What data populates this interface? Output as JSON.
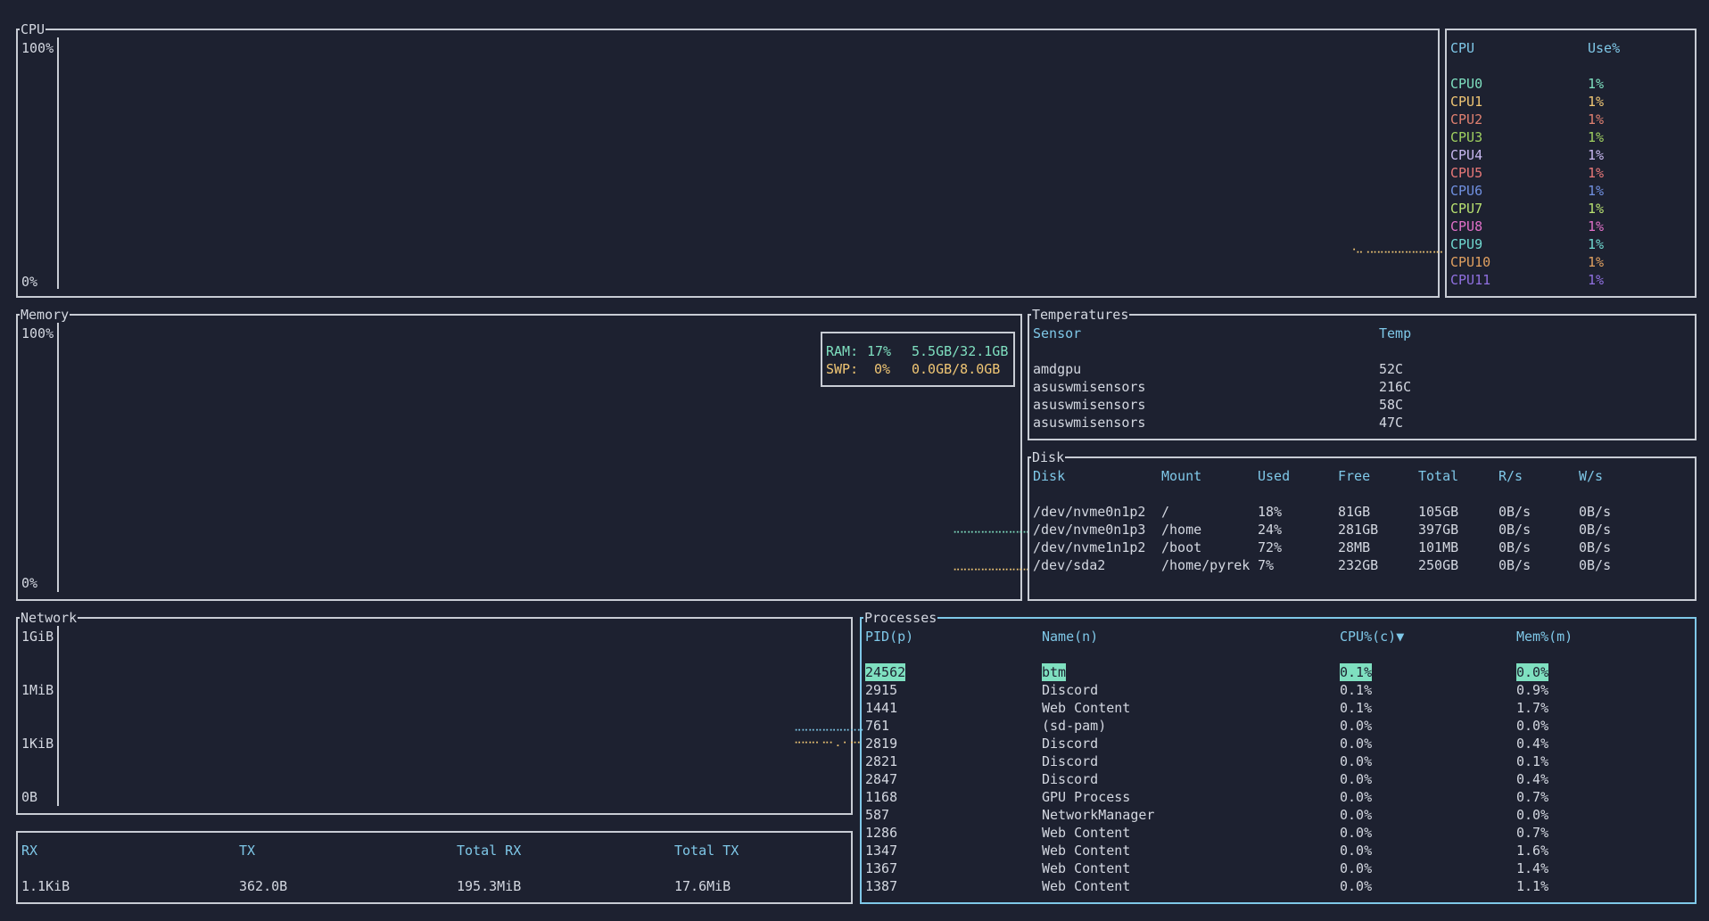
{
  "cpu_panel": {
    "title": "CPU",
    "y_max": "100%",
    "y_min": "0%"
  },
  "cpu_table": {
    "col_cpu": "CPU",
    "col_use": "Use%",
    "rows": [
      {
        "name": "CPU0",
        "use": "1%",
        "color": "#7fe0c0"
      },
      {
        "name": "CPU1",
        "use": "1%",
        "color": "#f0c674"
      },
      {
        "name": "CPU2",
        "use": "1%",
        "color": "#e08070"
      },
      {
        "name": "CPU3",
        "use": "1%",
        "color": "#a0d060"
      },
      {
        "name": "CPU4",
        "use": "1%",
        "color": "#c8b8f0"
      },
      {
        "name": "CPU5",
        "use": "1%",
        "color": "#e87878"
      },
      {
        "name": "CPU6",
        "use": "1%",
        "color": "#7090e0"
      },
      {
        "name": "CPU7",
        "use": "1%",
        "color": "#b8e070"
      },
      {
        "name": "CPU8",
        "use": "1%",
        "color": "#e070c8"
      },
      {
        "name": "CPU9",
        "use": "1%",
        "color": "#70d8d0"
      },
      {
        "name": "CPU10",
        "use": "1%",
        "color": "#e0a060"
      },
      {
        "name": "CPU11",
        "use": "1%",
        "color": "#9070e0"
      }
    ]
  },
  "memory_panel": {
    "title": "Memory",
    "y_max": "100%",
    "y_min": "0%",
    "legend": {
      "ram_label": "RAM:",
      "ram_pct": "17%",
      "ram_amount": "5.5GB/32.1GB",
      "swp_label": "SWP:",
      "swp_pct": "0%",
      "swp_amount": "0.0GB/8.0GB",
      "ram_color": "#7fe0c0",
      "swp_color": "#f0c674"
    }
  },
  "temperatures": {
    "title": "Temperatures",
    "col_sensor": "Sensor",
    "col_temp": "Temp",
    "rows": [
      {
        "sensor": "amdgpu",
        "temp": "52C"
      },
      {
        "sensor": "asuswmisensors",
        "temp": "216C"
      },
      {
        "sensor": "asuswmisensors",
        "temp": "58C"
      },
      {
        "sensor": "asuswmisensors",
        "temp": "47C"
      }
    ]
  },
  "disk": {
    "title": "Disk",
    "headers": [
      "Disk",
      "Mount",
      "Used",
      "Free",
      "Total",
      "R/s",
      "W/s"
    ],
    "rows": [
      [
        "/dev/nvme0n1p2",
        "/",
        "18%",
        "81GB",
        "105GB",
        "0B/s",
        "0B/s"
      ],
      [
        "/dev/nvme0n1p3",
        "/home",
        "24%",
        "281GB",
        "397GB",
        "0B/s",
        "0B/s"
      ],
      [
        "/dev/nvme1n1p2",
        "/boot",
        "72%",
        "28MB",
        "101MB",
        "0B/s",
        "0B/s"
      ],
      [
        "/dev/sda2",
        "/home/pyrek",
        "7%",
        "232GB",
        "250GB",
        "0B/s",
        "0B/s"
      ]
    ]
  },
  "network": {
    "title": "Network",
    "y_labels": [
      "1GiB",
      "1MiB",
      "1KiB",
      "0B"
    ],
    "rx_color": "#7fc8e8",
    "tx_color": "#f0c674"
  },
  "net_summary": {
    "headers": [
      "RX",
      "TX",
      "Total RX",
      "Total TX"
    ],
    "values": [
      "1.1KiB",
      "362.0B",
      "195.3MiB",
      "17.6MiB"
    ]
  },
  "processes": {
    "title": "Processes",
    "col_pid": "PID(p)",
    "col_name": "Name(n)",
    "col_cpu": "CPU%(c)▼",
    "col_mem": "Mem%(m)",
    "rows": [
      [
        "24562",
        "btm",
        "0.1%",
        "0.0%"
      ],
      [
        "2915",
        "Discord",
        "0.1%",
        "0.9%"
      ],
      [
        "1441",
        "Web Content",
        "0.1%",
        "1.7%"
      ],
      [
        "761",
        "(sd-pam)",
        "0.0%",
        "0.0%"
      ],
      [
        "2819",
        "Discord",
        "0.0%",
        "0.4%"
      ],
      [
        "2821",
        "Discord",
        "0.0%",
        "0.1%"
      ],
      [
        "2847",
        "Discord",
        "0.0%",
        "0.4%"
      ],
      [
        "1168",
        "GPU Process",
        "0.0%",
        "0.7%"
      ],
      [
        "587",
        "NetworkManager",
        "0.0%",
        "0.0%"
      ],
      [
        "1286",
        "Web Content",
        "0.0%",
        "0.7%"
      ],
      [
        "1347",
        "Web Content",
        "0.0%",
        "1.6%"
      ],
      [
        "1367",
        "Web Content",
        "0.0%",
        "1.4%"
      ],
      [
        "1387",
        "Web Content",
        "0.0%",
        "1.1%"
      ]
    ]
  }
}
